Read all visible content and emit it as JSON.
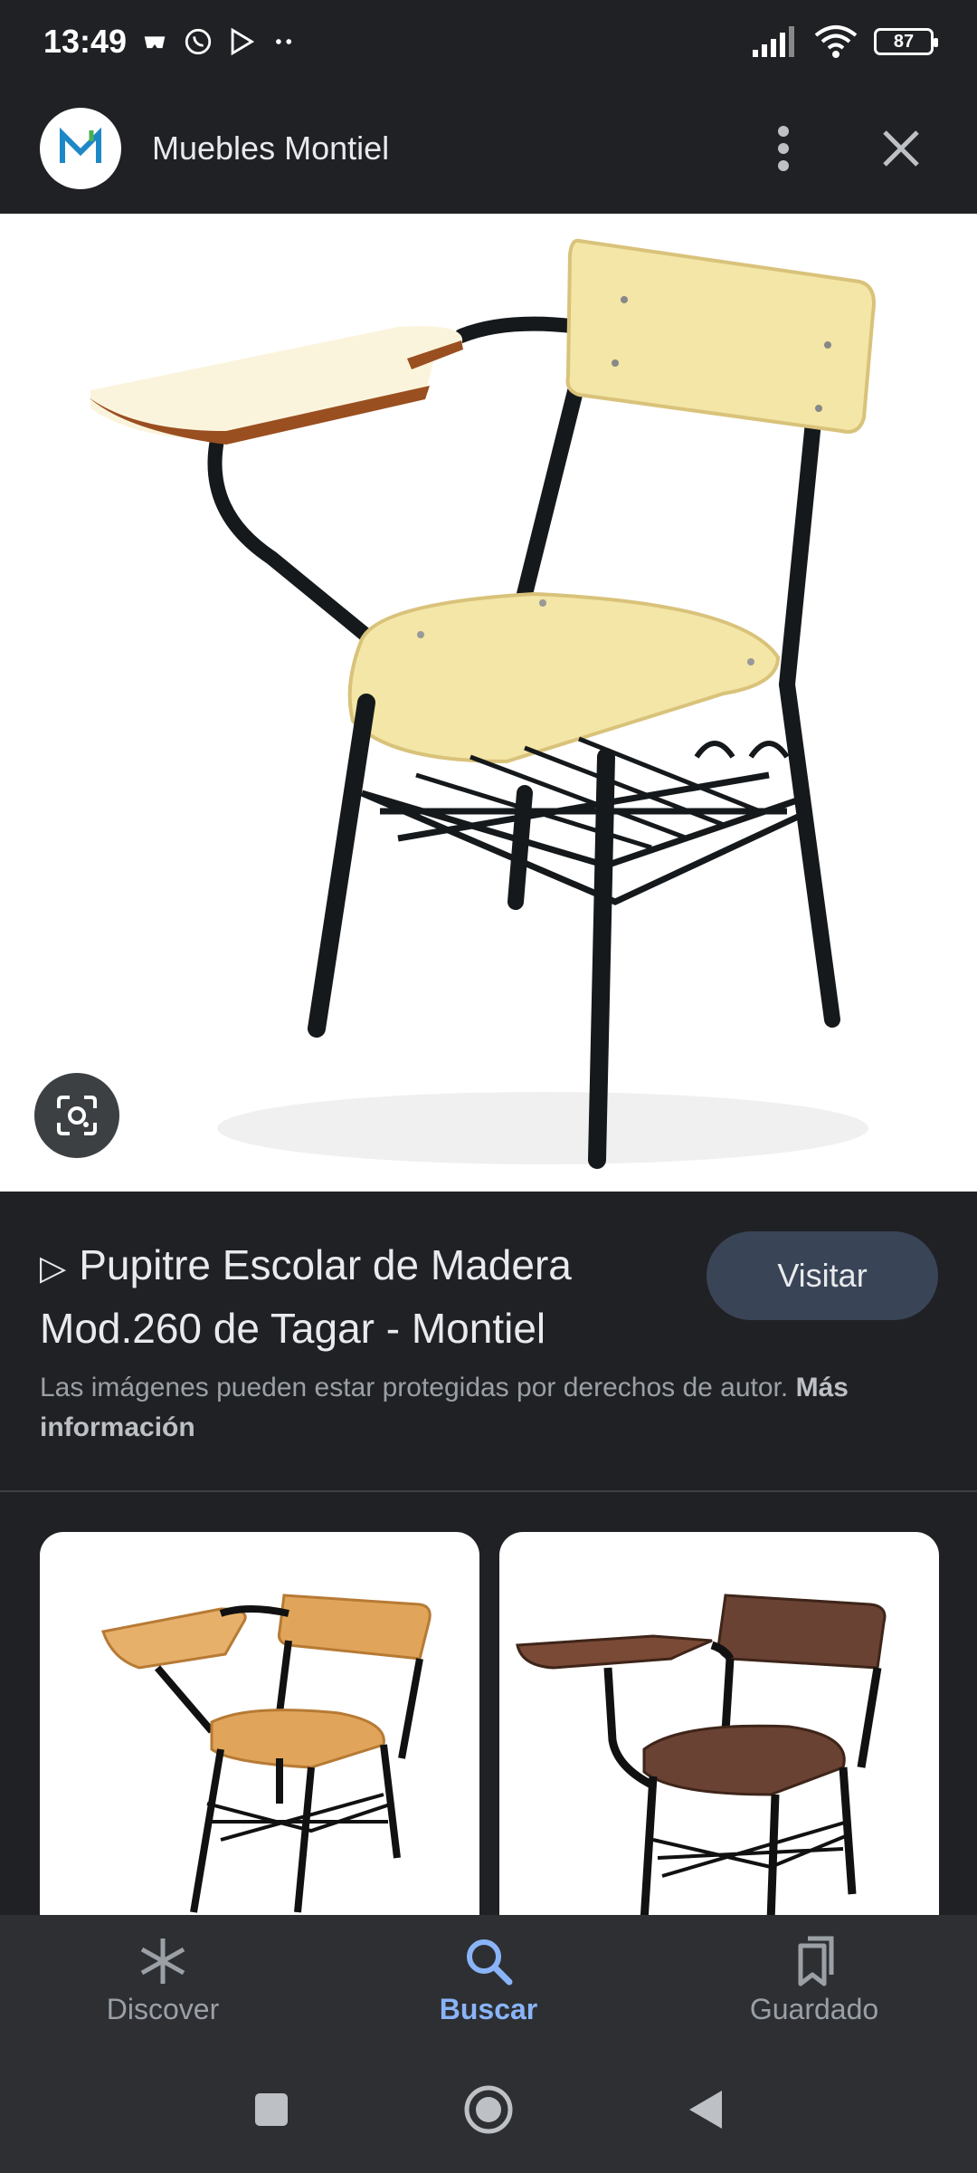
{
  "status_bar": {
    "time": "13:49",
    "battery": "87"
  },
  "header": {
    "site_name": "Muebles Montiel",
    "logo_icon": "montiel-logo-icon",
    "more_icon": "more-vert-icon",
    "close_icon": "close-icon"
  },
  "hero": {
    "image": "school-desk-chair-cream-image",
    "lens_icon": "google-lens-icon"
  },
  "result": {
    "play_glyph": "▷",
    "title": "Pupitre Escolar de Madera Mod.260 de Tagar - Montiel",
    "visit_label": "Visitar",
    "copyright_text": "Las imágenes pueden estar protegidas por derechos de autor.",
    "more_info": "Más información"
  },
  "related": [
    {
      "image": "wooden-desk-chair-light-image"
    },
    {
      "image": "wooden-desk-chair-dark-image"
    }
  ],
  "bottom_nav": {
    "items": [
      {
        "label": "Discover",
        "icon": "discover-asterisk-icon",
        "active": false
      },
      {
        "label": "Buscar",
        "icon": "search-icon",
        "active": true
      },
      {
        "label": "Guardado",
        "icon": "saved-bookmarks-icon",
        "active": false
      }
    ]
  },
  "colors": {
    "background": "#202124",
    "accent": "#8ab4f8",
    "visit_button": "#394457"
  }
}
